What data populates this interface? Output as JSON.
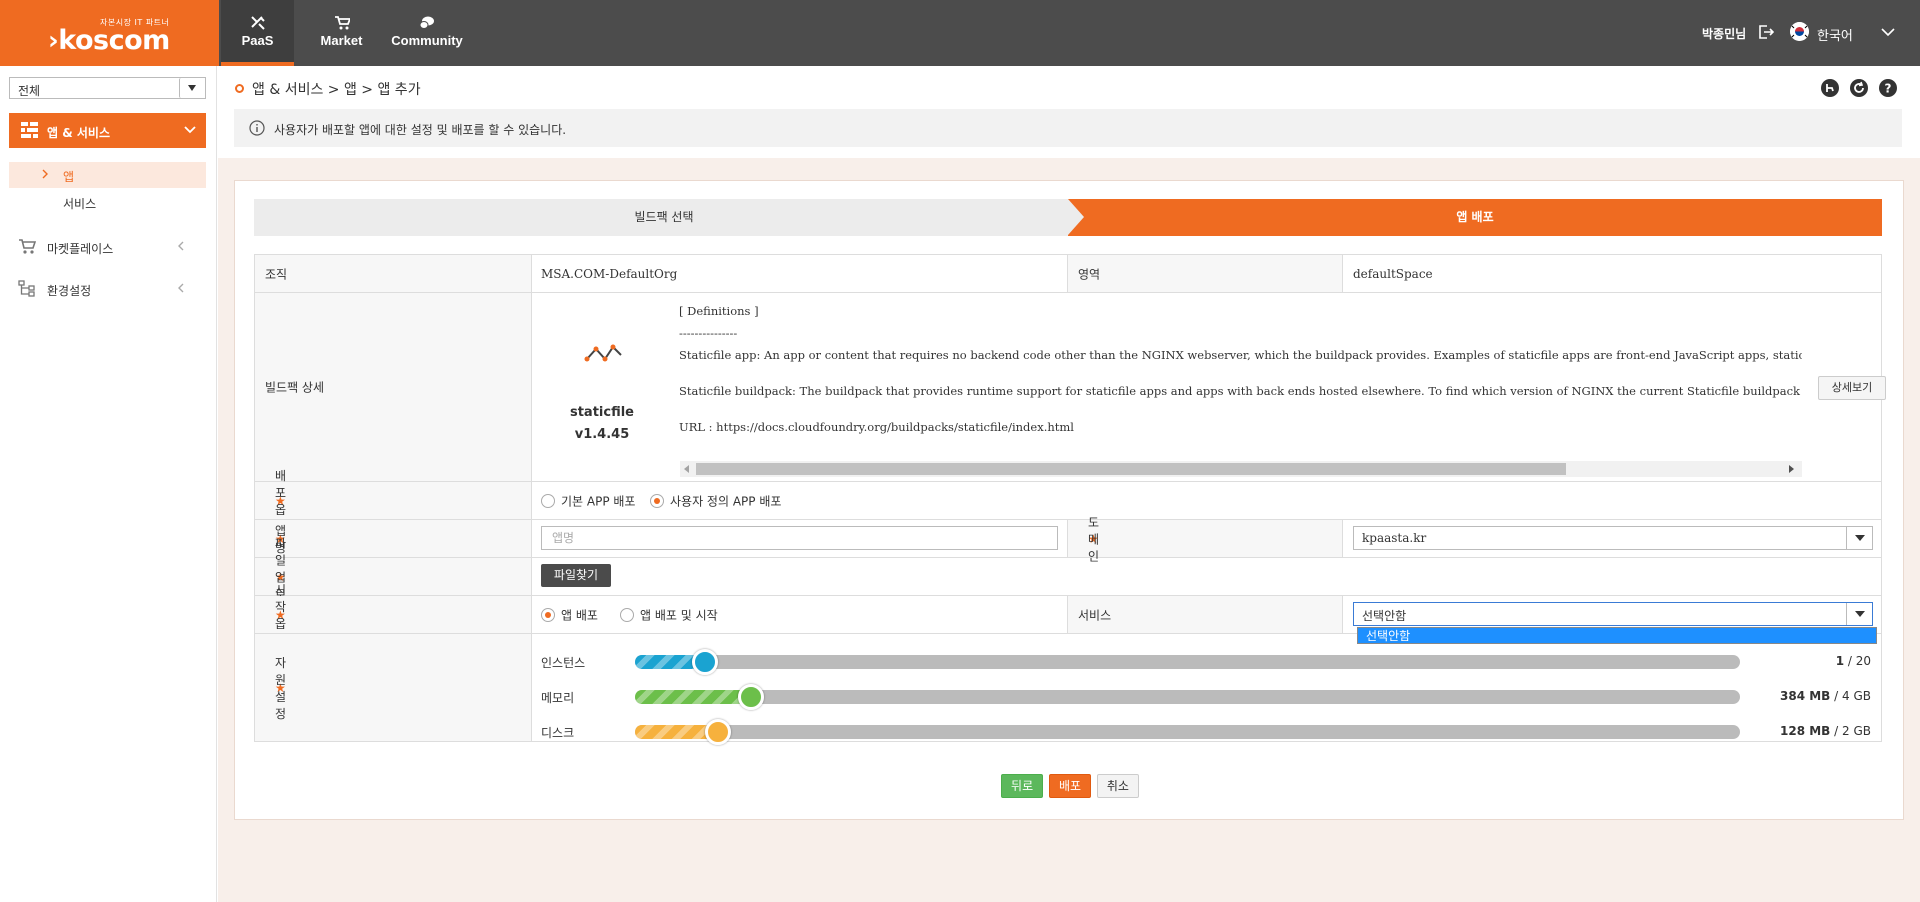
{
  "brand": {
    "tagline": "자본시장 IT 파트너",
    "name": "koscom"
  },
  "nav": {
    "paas": "PaaS",
    "market": "Market",
    "community": "Community"
  },
  "user": {
    "name": "박종민님",
    "language": "한국어"
  },
  "sidebar": {
    "scope_select": "전체",
    "active_menu": "앱 & 서비스",
    "sub_app": "앱",
    "sub_service": "서비스",
    "marketplace": "마켓플레이스",
    "settings": "환경설정"
  },
  "breadcrumb": "앱 & 서비스 > 앱 > 앱 추가",
  "info": "사용자가 배포할 앱에 대한 설정 및 배포를 할 수 있습니다.",
  "steps": {
    "step1": "빌드팩 선택",
    "step2": "앱 배포"
  },
  "form": {
    "org_label": "조직",
    "org_value": "MSA.COM-DefaultOrg",
    "space_label": "영역",
    "space_value": "defaultSpace",
    "buildpack_label": "빌드팩 상세",
    "buildpack_name": "staticfile",
    "buildpack_version": "v1.4.45",
    "desc_lines": [
      "[ Definitions ]",
      "---------------",
      "Staticfile app: An app or content that requires no backend code other than the NGINX webserver, which the buildpack provides. Examples of staticfile apps are front-end JavaScript apps, static H",
      "",
      "Staticfile buildpack: The buildpack that provides runtime support for staticfile apps and apps with back ends hosted elsewhere. To find which version of NGINX the current Staticfile buildpack use",
      "",
      "URL : https://docs.cloudfoundry.org/buildpacks/staticfile/index.html"
    ],
    "detail_button": "상세보기",
    "deploy_option_label": "배포 옵션",
    "deploy_option_basic": "기본 APP 배포",
    "deploy_option_custom": "사용자 정의 APP 배포",
    "deploy_option_selected": "custom",
    "app_name_label": "앱명",
    "app_name_value": "",
    "app_name_placeholder": "앱명",
    "domain_label": "도메인",
    "domain_value": "kpaasta.kr",
    "file_upload_label": "파일 업로드",
    "file_button": "파일찾기",
    "start_option_label": "시작옵션",
    "start_option_deploy": "앱 배포",
    "start_option_deploy_start": "앱 배포 및 시작",
    "start_option_selected": "deploy",
    "service_label": "서비스",
    "service_value": "선택안함",
    "service_dropdown_option": "선택안함",
    "resource_label": "자원설정"
  },
  "resources": {
    "instance": {
      "label": "인스턴스",
      "value": "1",
      "max": "20",
      "fraction": 0.063,
      "color": "#1aa3d1"
    },
    "memory": {
      "label": "메모리",
      "value": "384 MB",
      "max": "4 GB",
      "fraction": 0.105,
      "color": "#6cbf4a"
    },
    "disk": {
      "label": "디스크",
      "value": "128 MB",
      "max": "2 GB",
      "fraction": 0.075,
      "color": "#f6b13d"
    }
  },
  "actions": {
    "back": "뒤로",
    "deploy": "배포",
    "cancel": "취소"
  },
  "colors": {
    "accent": "#ef6b21",
    "topbar": "#4c4c4c"
  }
}
